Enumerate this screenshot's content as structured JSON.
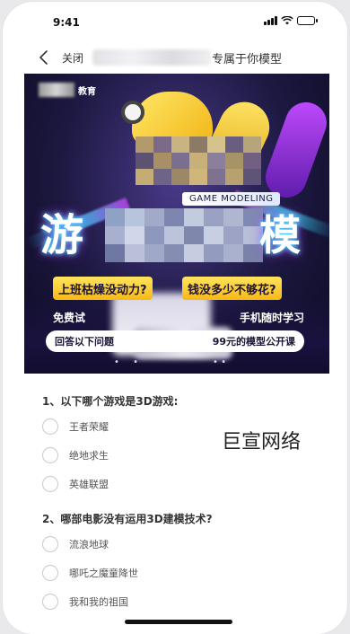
{
  "status_bar": {
    "time": "9:41",
    "icons": [
      "signal-icon",
      "wifi-icon",
      "battery-icon"
    ]
  },
  "nav": {
    "back_icon": "chevron-left-icon",
    "close_label": "关闭",
    "title_suffix": "专属于你模型"
  },
  "banner": {
    "brand_suffix": "教育",
    "game_modeling": "GAME MODELING",
    "title_left": "游",
    "title_right": "模",
    "pill_left": "上班枯燥没动力?",
    "pill_right": "钱没多少不够花?",
    "line_free": "免费试",
    "line_mobile": "手机随时学习",
    "cta_left": "回答以下问题",
    "cta_right": "99元的模型公开课",
    "footer_dots": "• •",
    "footer_suffix": "• •"
  },
  "survey": {
    "questions": [
      {
        "label": "1、以下哪个游戏是3D游戏:",
        "options": [
          "王者荣耀",
          "绝地求生",
          "英雄联盟"
        ]
      },
      {
        "label": "2、哪部电影没有运用3D建模技术?",
        "options": [
          "流浪地球",
          "哪吒之魔童降世",
          "我和我的祖国"
        ]
      }
    ]
  },
  "watermark": "巨宣网络",
  "colors": {
    "accent_yellow": "#f7b815",
    "neon_cyan": "#37e0ff",
    "neon_purple": "#b43cff"
  }
}
